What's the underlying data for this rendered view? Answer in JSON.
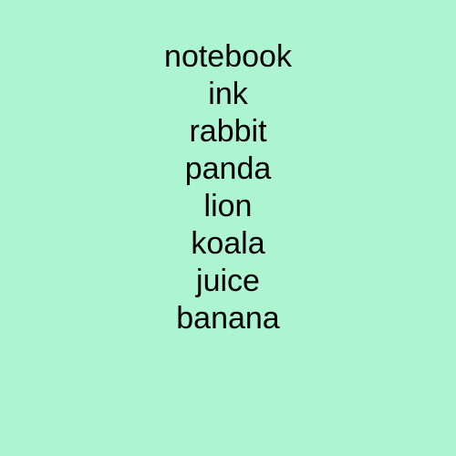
{
  "words": [
    "notebook",
    "ink",
    "rabbit",
    "panda",
    "lion",
    "koala",
    "juice",
    "banana"
  ],
  "colors": {
    "background": "#adf5d0",
    "text": "#000000"
  }
}
